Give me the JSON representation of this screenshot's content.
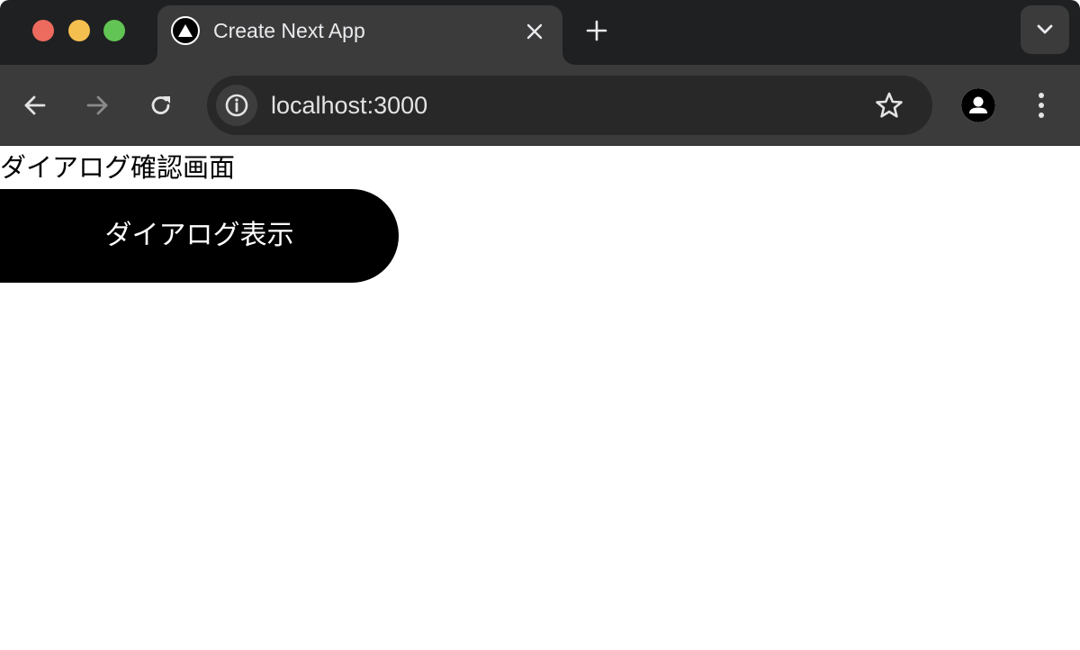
{
  "browser": {
    "tab": {
      "title": "Create Next App",
      "favicon": "nextjs-triangle-icon"
    },
    "address_bar": {
      "url": "localhost:3000"
    },
    "icons": {
      "close_tab": "close-icon",
      "new_tab": "plus-icon",
      "tab_search": "chevron-down-icon",
      "back": "arrow-left-icon",
      "forward": "arrow-right-icon",
      "reload": "reload-icon",
      "site_info": "info-icon",
      "bookmark": "star-icon",
      "profile": "person-icon",
      "menu": "kebab-menu-icon"
    },
    "colors": {
      "tab_strip": "#1f2021",
      "toolbar": "#3b3b3b",
      "omnibox": "#282828",
      "traffic_red": "#ed6a5e",
      "traffic_yellow": "#f5bf4f",
      "traffic_green": "#61c454"
    }
  },
  "page": {
    "heading": "ダイアログ確認画面",
    "button_label": "ダイアログ表示",
    "colors": {
      "button_bg": "#000000",
      "button_text": "#ffffff"
    }
  }
}
